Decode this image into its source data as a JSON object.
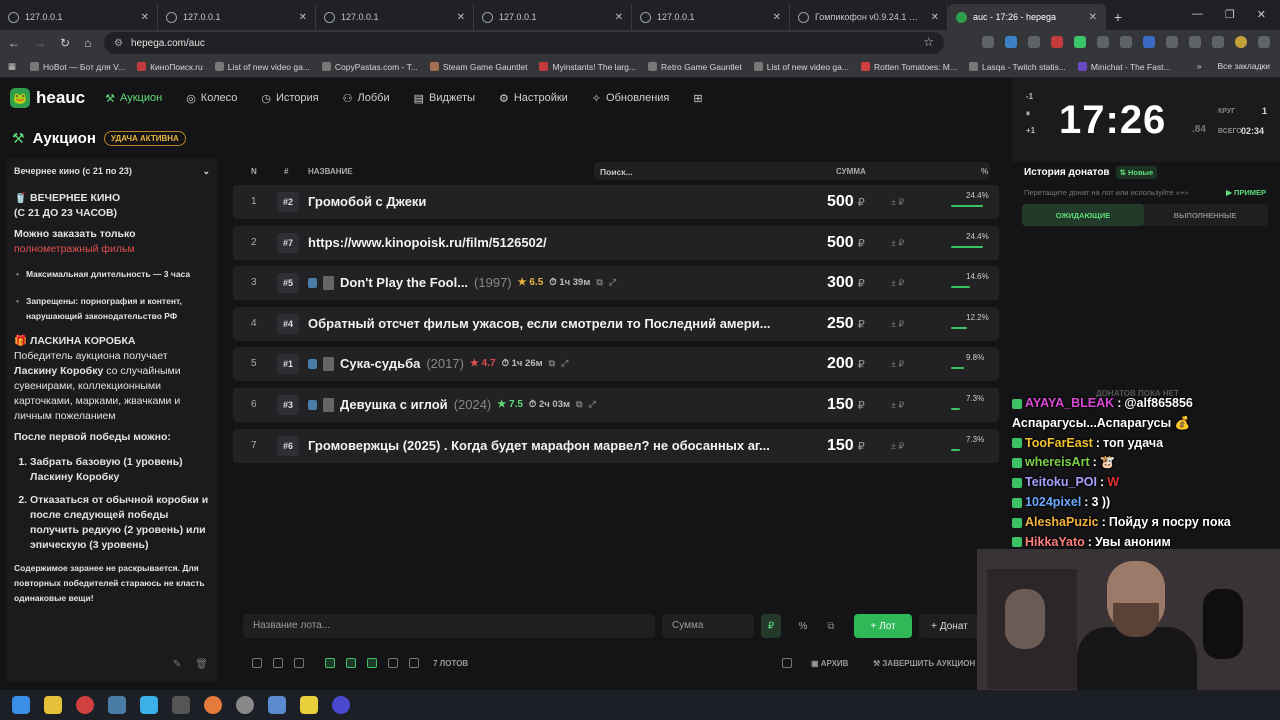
{
  "browser": {
    "tabs": [
      {
        "title": "127.0.0.1",
        "active": false
      },
      {
        "title": "127.0.0.1",
        "active": false
      },
      {
        "title": "127.0.0.1",
        "active": false
      },
      {
        "title": "127.0.0.1",
        "active": false
      },
      {
        "title": "127.0.0.1",
        "active": false
      },
      {
        "title": "Гомпикофон v0.9.24.1 — упр",
        "active": false
      },
      {
        "title": "auc - 17:26 - hepega",
        "active": true
      }
    ],
    "url": "hepega.com/auc",
    "bookmarks": [
      "HoBot — Бот для V...",
      "КиноПоиск.ru",
      "List of new video ga...",
      "CopyPastas.com - T...",
      "Steam Game Gauntlet",
      "Myinstants! The larg...",
      "Retro Game Gauntlet",
      "List of new video ga...",
      "Rotten Tomatoes: M...",
      "Lasqa - Twitch statis...",
      "Minichat - The Fast..."
    ],
    "all_bookmarks": "Все закладки"
  },
  "nav": {
    "logo": "heauc",
    "items": [
      "Аукцион",
      "Колесо",
      "История",
      "Лобби",
      "Виджеты",
      "Настройки",
      "Обновления"
    ]
  },
  "page": {
    "title": "Аукцион",
    "luck_badge": "УДАЧА АКТИВНА"
  },
  "sidebar": {
    "selector": "Вечернее кино (с 21 по 23)",
    "h1": "🥤 ВЕЧЕРНЕЕ КИНО",
    "h1_sub": "(С 21 ДО 23 ЧАСОВ)",
    "order_only": "Можно заказать только",
    "order_red": "полнометражный фильм",
    "rule1": "Максимальная длительность — 3 часа",
    "rule2": "Запрещены: порнография и контент, нарушающий законодательство РФ",
    "h2": "🎁 ЛАСКИНА КОРОБКА",
    "p1a": "Победитель аукциона получает",
    "p1b": "Ласкину Коробку",
    "p1c": "со случайными сувенирами, коллекционными карточками, марками, жвачками и личным пожеланием",
    "after": "После первой победы можно:",
    "opt1": "Забрать базовую (1 уровень) Ласкину Коробку",
    "opt2a": "Отказаться от обычной коробки и после следующей победы получить",
    "opt2b": "редкую",
    "opt2c": "(2 уровень) или",
    "opt2d": "эпическую",
    "opt2e": "(3 уровень)",
    "footer": "Содержимое заранее не раскрывается. Для повторных победителей стараюсь не класть одинаковые вещи!"
  },
  "table": {
    "headers": {
      "n": "N",
      "id": "#",
      "name": "НАЗВАНИЕ",
      "search": "Поиск...",
      "sum": "СУММА",
      "pct": "%"
    },
    "currency": "₽",
    "pm": "± ₽",
    "rows": [
      {
        "n": "1",
        "id": "#2",
        "name": "Громобой с Джеки",
        "year": "",
        "rating": "",
        "duration": "",
        "sum": "500",
        "pct": "24.4%",
        "bar": 0.244
      },
      {
        "n": "2",
        "id": "#7",
        "name": "https://www.kinopoisk.ru/film/5126502/",
        "year": "",
        "rating": "",
        "duration": "",
        "sum": "500",
        "pct": "24.4%",
        "bar": 0.244
      },
      {
        "n": "3",
        "id": "#5",
        "name": "Don't Play the Fool...",
        "year": "(1997)",
        "rating": "★ 6.5",
        "duration": "⏱ 1ч 39м",
        "sum": "300",
        "pct": "14.6%",
        "bar": 0.146,
        "rating_color": "#e6b33f"
      },
      {
        "n": "4",
        "id": "#4",
        "name": "Обратный отсчет фильм ужасов, если смотрели то Последний амери...",
        "year": "",
        "rating": "",
        "duration": "",
        "sum": "250",
        "pct": "12.2%",
        "bar": 0.122
      },
      {
        "n": "5",
        "id": "#1",
        "name": "Сука-судьба",
        "year": "(2017)",
        "rating": "★ 4.7",
        "duration": "⏱ 1ч 26м",
        "sum": "200",
        "pct": "9.8%",
        "bar": 0.098,
        "rating_color": "#e05050"
      },
      {
        "n": "6",
        "id": "#3",
        "name": "Девушка с иглой",
        "year": "(2024)",
        "rating": "★ 7.5",
        "duration": "⏱ 2ч 03м",
        "sum": "150",
        "pct": "7.3%",
        "bar": 0.073,
        "rating_color": "#5fdc7a"
      },
      {
        "n": "7",
        "id": "#6",
        "name": "Громовержцы (2025) . Когда будет марафон марвел? не обосанных аг...",
        "year": "",
        "rating": "",
        "duration": "",
        "sum": "150",
        "pct": "7.3%",
        "bar": 0.073
      }
    ]
  },
  "bottom": {
    "lot_placeholder": "Название лота...",
    "sum_placeholder": "Сумма",
    "rub": "₽",
    "pct": "%",
    "add_lot": "Лот",
    "donate": "Донат",
    "lot_count": "7 ЛОТОВ",
    "archive": "АРХИВ",
    "finish": "ЗАВЕРШИТЬ АУКЦИОН"
  },
  "timer": {
    "minus": "-1",
    "plus": "+1",
    "time": "17:26",
    "ms": ".84",
    "round_label": "КРУГ",
    "round_value": "1",
    "total_label": "ВСЕГО",
    "total_value": "02:34"
  },
  "donations": {
    "title": "История донатов",
    "new_badge": "Новые",
    "hint": "Перетащите донат на лот или используйте «+»",
    "example": "ПРИМЕР",
    "tab_pending": "ОЖИДАЮЩИЕ",
    "tab_done": "ВЫПОЛНЕННЫЕ",
    "empty": "ДОНАТОВ ПОКА НЕТ"
  },
  "chat": [
    {
      "user": "AYAYA_BLEAK",
      "msg": "@alf865856",
      "color": "#d94ad9"
    },
    {
      "user": "",
      "msg": "Аспарагусы...Аспарагусы 💰",
      "color": "#ffffff"
    },
    {
      "user": "TooFarEast",
      "msg": "топ удача",
      "color": "#f2c230"
    },
    {
      "user": "whereisArt",
      "msg": "🐮",
      "color": "#7cd04a"
    },
    {
      "user": "Teitoku_POI",
      "msg": "W",
      "color": "#a8a0ff",
      "msg_color": "#e03030"
    },
    {
      "user": "1024pixel",
      "msg": "3 ))",
      "color": "#6aa8ff"
    },
    {
      "user": "AleshaPuzic",
      "msg": "Пойду я посру пока",
      "color": "#f2b43c"
    },
    {
      "user": "HikkaYato",
      "msg": "Увы аноним",
      "color": "#ff7f7f"
    }
  ]
}
